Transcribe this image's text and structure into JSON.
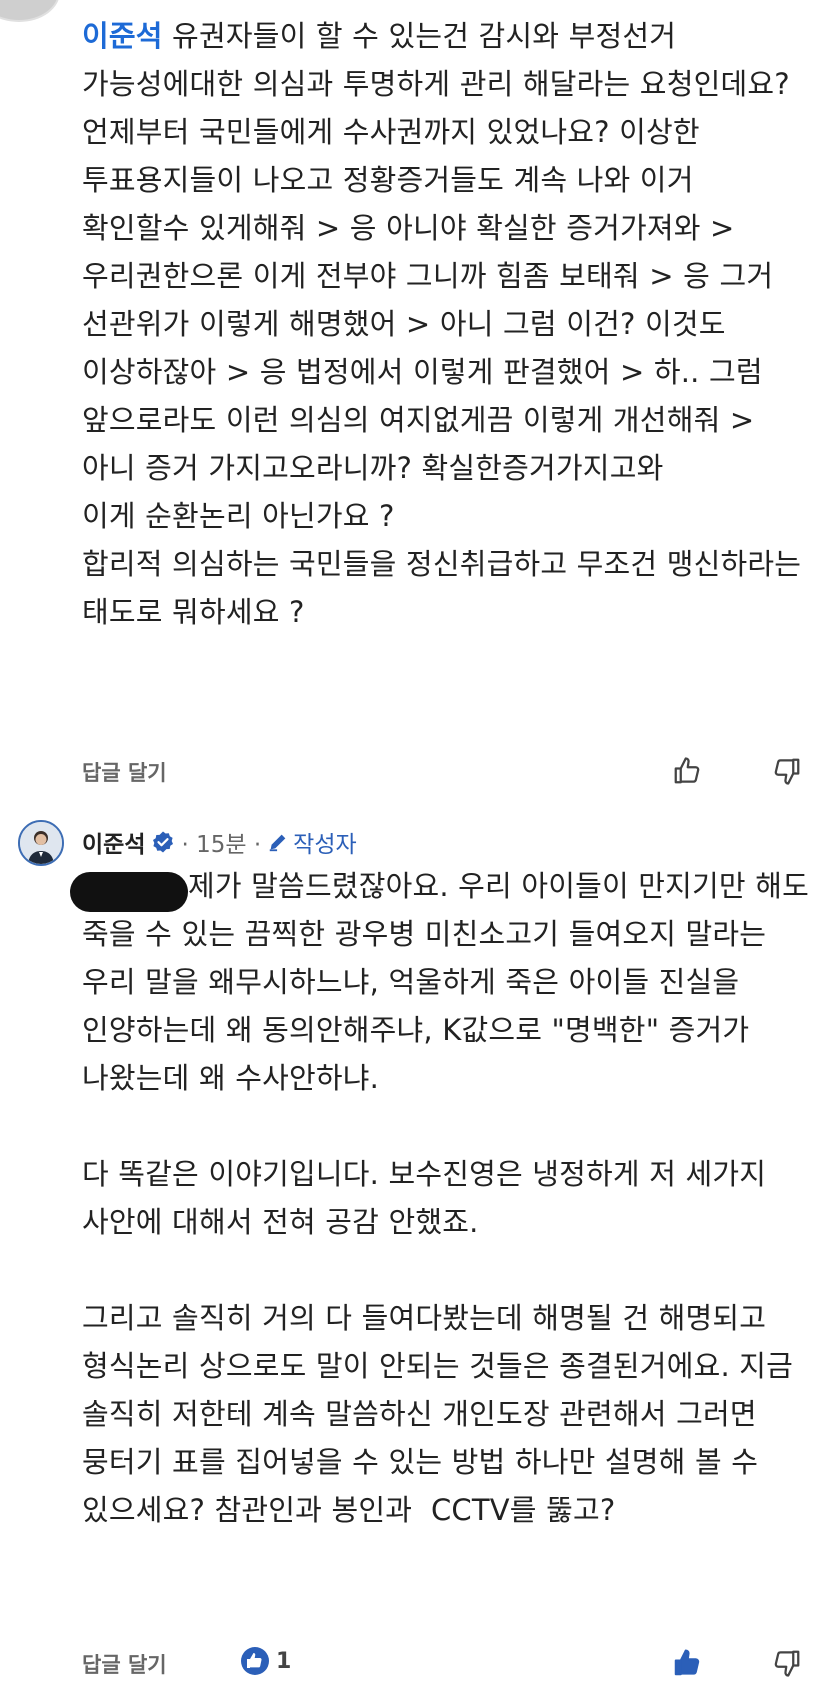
{
  "comment1": {
    "mention": "이준석",
    "body": " 유권자들이 할 수 있는건 감시와 부정선거 가능성에대한 의심과 투명하게 관리 해달라는 요청인데요? 언제부터 국민들에게 수사권까지 있었나요? 이상한 투표용지들이 나오고 정황증거들도 계속 나와 이거 확인할수 있게해줘 > 응 아니야 확실한 증거가져와 > 우리권한으론 이게 전부야 그니까 힘좀 보태줘 > 응 그거 선관위가 이렇게 해명했어 > 아니 그럼 이건? 이것도 이상하잖아 > 응 법정에서 이렇게 판결했어 > 하.. 그럼 앞으로라도 이런 의심의 여지없게끔 이렇게 개선해줘 > 아니 증거 가지고오라니까? 확실한증거가지고와\n이게 순환논리 아닌가요 ?\n합리적 의심하는 국민들을 정신취급하고 무조건 맹신하라는 태도로 뭐하세요 ?",
    "reply_label": "답글 달기"
  },
  "comment2": {
    "author": "이준석",
    "time": "· 15분 ·",
    "writer_badge": "작성자",
    "body": "제가 말씀드렸잖아요. 우리 아이들이 만지기만 해도 죽을 수 있는 끔찍한 광우병 미친소고기 들여오지 말라는 우리 말을 왜무시하느냐, 억울하게 죽은 아이들 진실을 인양하는데 왜 동의안해주냐, K값으로 \"명백한\" 증거가 나왔는데 왜 수사안하냐.\n\n다 똑같은 이야기입니다. 보수진영은 냉정하게 저 세가지 사안에 대해서 전혀 공감 안했죠.\n\n그리고 솔직히 거의 다 들여다봤는데 해명될 건 해명되고 형식논리 상으로도 말이 안되는 것들은 종결된거에요. 지금 솔직히 저한테 계속 말씀하신 개인도장 관련해서 그러면 뭉터기 표를 집어넣을 수 있는 방법 하나만 설명해 볼 수 있으세요? 참관인과 봉인과  CCTV를 뚫고?",
    "reply_label": "답글 달기",
    "like_count": "1"
  },
  "colors": {
    "mention": "#1d6ad6",
    "writer_badge": "#2b5fb8",
    "like_active": "#2b5fb8"
  }
}
